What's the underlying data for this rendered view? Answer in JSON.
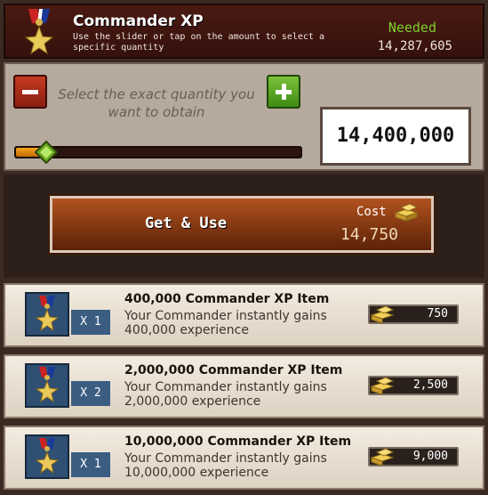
{
  "header": {
    "title": "Commander XP",
    "description": "Use the slider or tap on the amount to select a specific quantity",
    "needed_label": "Needed",
    "needed_value": "14,287,605",
    "medal_icon": "medal-star-icon"
  },
  "selector": {
    "instruction": "Select the exact quantity you want to obtain",
    "quantity": "14,400,000",
    "slider_fill_fraction": 0.13,
    "minus_icon": "minus-icon",
    "plus_icon": "plus-icon"
  },
  "action": {
    "button_label": "Get & Use",
    "cost_label": "Cost",
    "cost_value": "14,750",
    "cost_icon": "gold-bars-icon"
  },
  "items": [
    {
      "title": "400,000 Commander XP Item",
      "desc": "Your Commander instantly gains 400,000 experience",
      "qty": "X 1",
      "price": "750"
    },
    {
      "title": "2,000,000 Commander XP Item",
      "desc": "Your Commander instantly gains 2,000,000 experience",
      "qty": "X 2",
      "price": "2,500"
    },
    {
      "title": "10,000,000 Commander XP Item",
      "desc": "Your Commander instantly gains 10,000,000 experience",
      "qty": "X 1",
      "price": "9,000"
    }
  ],
  "colors": {
    "header_bg": "#4a1a12",
    "needed": "#7ecf2a",
    "slider_fill": "#f5a51a",
    "plus_button": "#7cc23a",
    "minus_button": "#c43a22"
  }
}
